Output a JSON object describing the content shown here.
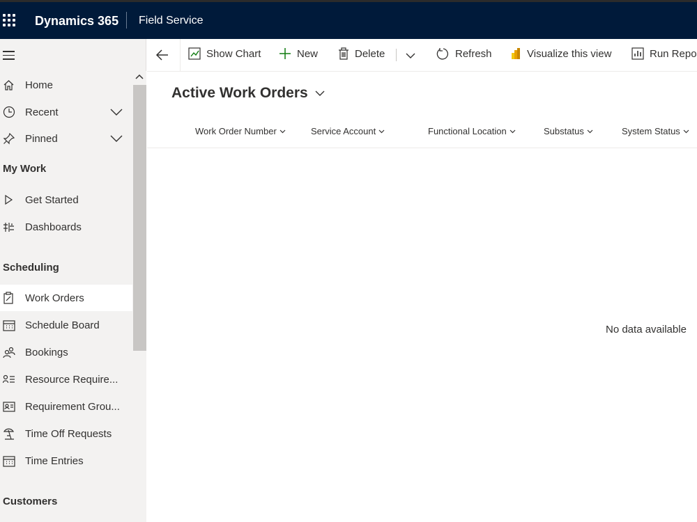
{
  "topbar": {
    "brand": "Dynamics 365",
    "app_name": "Field Service"
  },
  "sidebar": {
    "items": [
      {
        "label": "Home",
        "icon": "home-icon"
      },
      {
        "label": "Recent",
        "icon": "clock-icon"
      },
      {
        "label": "Pinned",
        "icon": "pin-icon"
      }
    ],
    "groups": [
      {
        "label": "My Work",
        "items": [
          {
            "label": "Get Started",
            "icon": "play-icon"
          },
          {
            "label": "Dashboards",
            "icon": "dashboard-icon"
          }
        ]
      },
      {
        "label": "Scheduling",
        "items": [
          {
            "label": "Work Orders",
            "icon": "clipboard-icon",
            "active": true
          },
          {
            "label": "Schedule Board",
            "icon": "calendar-icon"
          },
          {
            "label": "Bookings",
            "icon": "people-icon"
          },
          {
            "label": "Resource Require...",
            "icon": "person-list-icon"
          },
          {
            "label": "Requirement Grou...",
            "icon": "contact-card-icon"
          },
          {
            "label": "Time Off Requests",
            "icon": "beach-icon"
          },
          {
            "label": "Time Entries",
            "icon": "calendar-icon"
          }
        ]
      },
      {
        "label": "Customers",
        "items": []
      }
    ]
  },
  "commandbar": {
    "show_chart": "Show Chart",
    "new": "New",
    "delete": "Delete",
    "refresh": "Refresh",
    "visualize": "Visualize this view",
    "run_report": "Run Repo"
  },
  "view": {
    "title": "Active Work Orders",
    "columns": [
      "Work Order Number",
      "Service Account",
      "Functional Location",
      "Substatus",
      "System Status"
    ],
    "empty_message": "No data available"
  },
  "colors": {
    "topbar": "#001a3a",
    "sidebar": "#f3f2f1",
    "accent_green": "#107c10",
    "powerbi_yellow": "#f2c811"
  }
}
